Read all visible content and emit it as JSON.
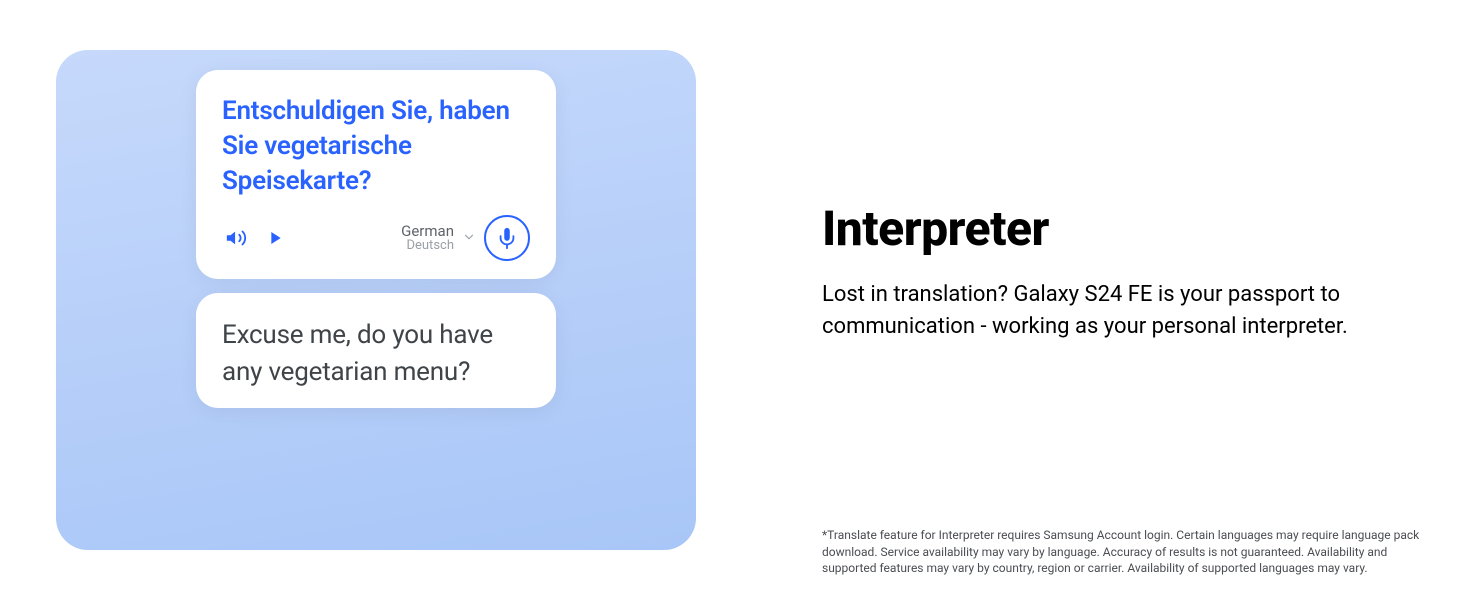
{
  "phone": {
    "source_text": "Entschuldigen Sie, haben Sie vegetarische Speisekarte?",
    "language_primary": "German",
    "language_secondary": "Deutsch",
    "target_text": "Excuse me, do you have any vegetarian menu?"
  },
  "content": {
    "heading": "Interpreter",
    "body": "Lost in translation? Galaxy S24 FE is your passport to communication - working as your personal interpreter."
  },
  "disclaimer": "*Translate feature for Interpreter requires Samsung Account login. Certain languages may require language pack download. Service availability may vary by language. Accuracy of results is not guaranteed. Availability and supported features may vary by country, region or carrier. Availability of supported languages may vary."
}
